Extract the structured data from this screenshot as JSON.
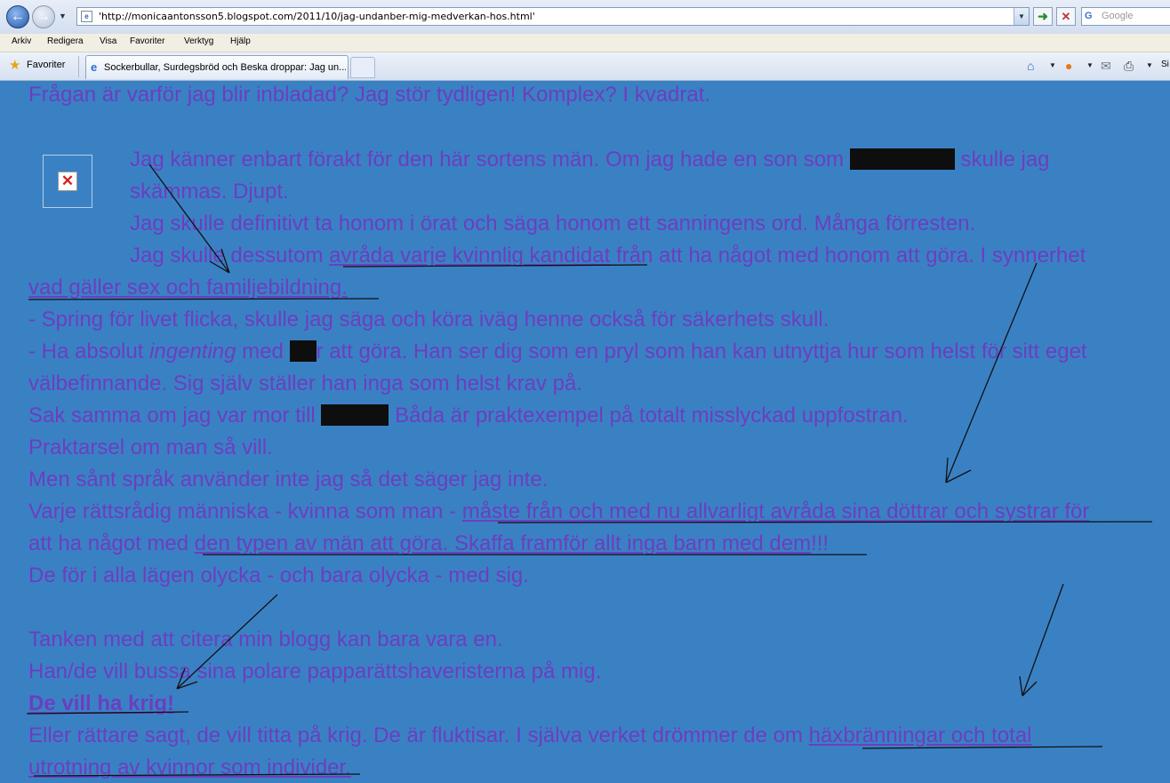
{
  "browser": {
    "url": "'http://monicaantonsson5.blogspot.com/2011/10/jag-undanber-mig-medverkan-hos.html'",
    "search_placeholder": "Google",
    "menu": [
      "Arkiv",
      "Redigera",
      "Visa",
      "Favoriter",
      "Verktyg",
      "Hjälp"
    ],
    "favorites_label": "Favoriter",
    "tab_title": "Sockerbullar, Surdegsbröd och Beska droppar: Jag un...",
    "toolbar_cut_text": "Si"
  },
  "article": {
    "l01": "Frågan är varför jag blir inbladad? Jag stör tydligen! Komplex? I kvadrat.",
    "l02a": "Jag känner enbart förakt för den här sortens män. Om jag hade en son som",
    "l02b": "skulle jag",
    "l03": "skämmas. Djupt.",
    "l04": "Jag skulle definitivt ta honom i örat och säga honom ett sanningens ord. Många förresten.",
    "l05a": "Jag skulle dessutom ",
    "l05b": "avråda varje kvinnlig kandidat",
    "l05c": " från att ha något med honom att göra. I synnerhet",
    "l06": "vad gäller sex och familjebildning.",
    "l07": "- Spring för livet flicka, skulle jag säga och köra iväg henne också för säkerhets skull.",
    "l08a": "- Ha absolut ",
    "l08b": "ingenting",
    "l08c": " med",
    "l08d": "r att göra. Han ser dig som en pryl som han kan utnyttja hur som helst för sitt eget",
    "l09": "välbefinnande. Sig själv ställer han inga som helst krav på.",
    "l10a": "Sak samma om jag var mor till",
    "l10b": " Båda är praktexempel på totalt misslyckad uppfostran.",
    "l11": "Praktarsel om man så vill.",
    "l12": "Men sånt språk använder inte jag så det säger jag inte.",
    "l13a": "Varje rättsrådig människa - kvinna som man - ",
    "l13b": "måste från och med nu allvarligt avråda sina döttrar och systrar för",
    "l14a": "att ha något med ",
    "l14b": "den typen av män att göra. Skaffa framför allt inga barn med dem",
    "l14c": "!!!",
    "l15": "De för i alla lägen olycka - och bara olycka - med sig.",
    "l16": "Tanken med att citera min blogg kan bara vara en.",
    "l17": "Han/de vill bussa sina polare papparättshaveristerna på mig.",
    "l18": "De vill ha krig!",
    "l19a": "Eller rättare sagt, de vill titta på krig. De är fluktisar. I själva verket drömmer de om ",
    "l19b": "häxbränningar och total",
    "l20": "utrotning av kvinnor som individer."
  },
  "colors": {
    "page_bg": "#3a81c4",
    "text": "#6c3ec0",
    "annotation": "#111111",
    "redaction": "#0e0e0e"
  },
  "icons": [
    "back-icon",
    "forward-icon",
    "refresh-icon",
    "stop-icon",
    "search-engine-icon",
    "favorites-star-icon",
    "tab-favicon",
    "home-icon",
    "feeds-icon",
    "mail-icon",
    "print-icon",
    "broken-image-icon"
  ]
}
